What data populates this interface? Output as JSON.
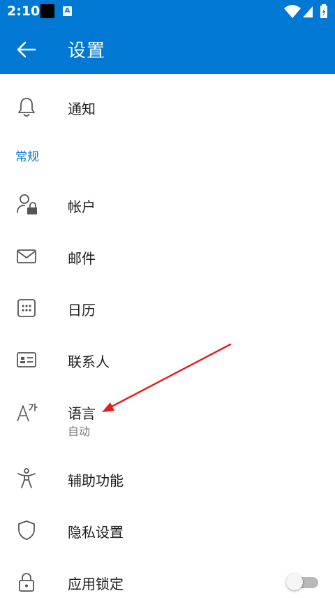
{
  "status": {
    "time": "2:10",
    "a_badge": "A"
  },
  "header": {
    "title": "设置"
  },
  "items": {
    "notifications": "通知",
    "section_general": "常规",
    "account": "帐户",
    "mail": "邮件",
    "calendar": "日历",
    "contacts": "联系人",
    "language": "语言",
    "language_value": "自动",
    "accessibility": "辅助功能",
    "privacy": "隐私设置",
    "app_lock": "应用锁定"
  },
  "app_lock_enabled": false,
  "colors": {
    "accent": "#0078d4",
    "annotation": "#e02020"
  }
}
